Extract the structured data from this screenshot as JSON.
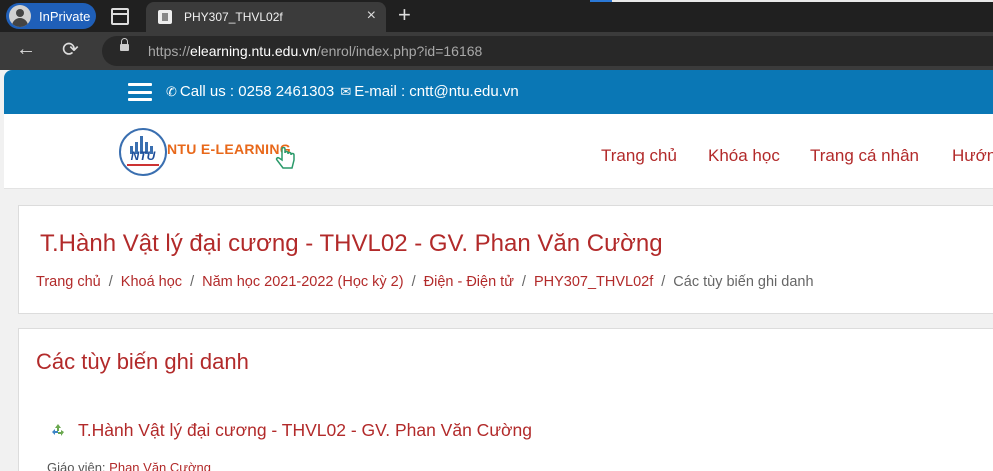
{
  "browser": {
    "profile_label": "InPrivate",
    "tab_title": "PHY307_THVL02f",
    "tab_close": "×",
    "new_tab": "+",
    "back": "←",
    "reload": "⟳",
    "url_scheme": "https://",
    "url_host": "elearning.ntu.edu.vn",
    "url_path": "/enrol/index.php?id=16168"
  },
  "topbar": {
    "phone_label": "Call us : 0258 2461303",
    "email_label": "E-mail : cntt@ntu.edu.vn"
  },
  "header": {
    "logo_text": "NTU",
    "brand": "NTU E-LEARNING",
    "nav": [
      "Trang chủ",
      "Khóa học",
      "Trang cá nhân",
      "Hướng"
    ]
  },
  "course_header": {
    "title": "T.Hành Vật lý đại cương - THVL02 - GV. Phan Văn Cường",
    "breadcrumbs": [
      "Trang chủ",
      "Khoá học",
      "Năm học 2021-2022 (Học kỳ 2)",
      "Điện - Điện tử",
      "PHY307_THVL02f"
    ],
    "breadcrumb_current": "Các tùy biến ghi danh",
    "separator": "/"
  },
  "enrol": {
    "heading": "Các tùy biến ghi danh",
    "course_link": "T.Hành Vật lý đại cương - THVL02 - GV. Phan Văn Cường",
    "teacher_label": "Giáo viên:",
    "teacher_name": "Phan Văn Cường"
  },
  "colors": {
    "accent_blue": "#0a77b5",
    "link_red": "#b22a2a",
    "brand_orange": "#e8681a"
  }
}
